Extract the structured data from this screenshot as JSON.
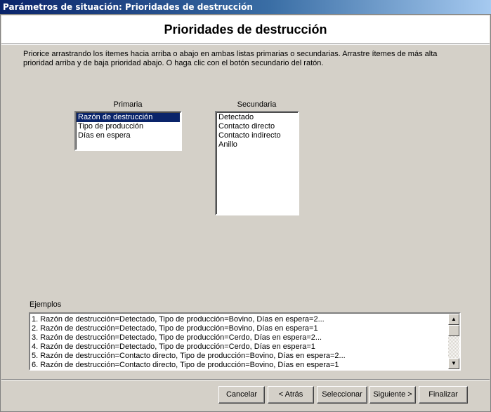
{
  "window": {
    "title": "Parámetros de situación: Prioridades de destrucción"
  },
  "header": {
    "title": "Prioridades de destrucción"
  },
  "instructions": "Priorice arrastrando los ítemes hacia arriba o abajo en ambas listas primarias o secundarias.  Arrastre ítemes de más alta prioridad arriba y de baja prioridad abajo.  O  haga clic con el botón secundario del ratón.",
  "primary": {
    "label": "Primaria",
    "items": [
      "Razón de destrucción",
      "Tipo de producción",
      "Días en espera"
    ],
    "selected_index": 0
  },
  "secondary": {
    "label": "Secundaria",
    "items": [
      "Detectado",
      "Contacto directo",
      "Contacto indirecto",
      "Anillo"
    ]
  },
  "examples": {
    "label": "Ejemplos",
    "lines": [
      "1. Razón de destrucción=Detectado, Tipo de producción=Bovino, Días en espera=2...",
      "2. Razón de destrucción=Detectado, Tipo de producción=Bovino, Días en espera=1",
      "3. Razón de destrucción=Detectado, Tipo de producción=Cerdo, Días en espera=2...",
      "4. Razón de destrucción=Detectado, Tipo de producción=Cerdo, Días en espera=1",
      "5. Razón de destrucción=Contacto directo, Tipo de producción=Bovino, Días en espera=2...",
      "6. Razón de destrucción=Contacto directo, Tipo de producción=Bovino, Días en espera=1"
    ],
    "scroll_up_icon": "arrow-up",
    "scroll_down_icon": "arrow-down"
  },
  "buttons": {
    "cancel": "Cancelar",
    "back": "< Atrás",
    "select": "Seleccionar",
    "next": "Siguiente >",
    "finish": "Finalizar"
  },
  "colors": {
    "titlebar_start": "#0a246a",
    "titlebar_end": "#a6caf0",
    "selection": "#0a246a",
    "dialog_bg": "#d4d0c8"
  }
}
